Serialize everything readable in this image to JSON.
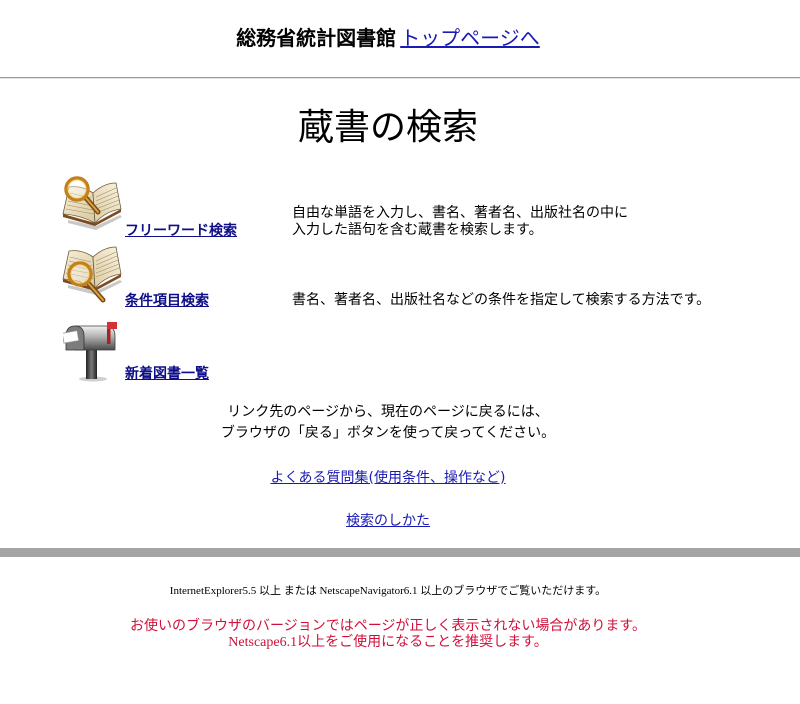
{
  "header": {
    "org_name": "総務省統計図書館",
    "top_link_label": "トップページへ"
  },
  "page_title": "蔵書の検索",
  "menu": [
    {
      "icon": "book-magnifier-icon",
      "label": "フリーワード検索",
      "description": [
        "自由な単語を入力し、書名、著者名、出版社名の中に",
        "入力した語句を含む蔵書を検索します。"
      ]
    },
    {
      "icon": "book-magnifier-icon",
      "label": "条件項目検索",
      "description": [
        "書名、著者名、出版社名などの条件を指定して検索する方法です。"
      ]
    },
    {
      "icon": "mailbox-icon",
      "label": "新着図書一覧",
      "description": []
    }
  ],
  "back_note": [
    "リンク先のページから、現在のページに戻るには、",
    "ブラウザの「戻る」ボタンを使って戻ってください。"
  ],
  "links": {
    "faq_label": "よくある質問集(使用条件、操作など)",
    "howto_label": "検索のしかた"
  },
  "footer": {
    "browser_note": "InternetExplorer5.5 以上 または NetscapeNavigator6.1 以上のブラウザでご覧いただけます。",
    "warning": [
      "お使いのブラウザのバージョンではページが正しく表示されない場合があります。",
      "Netscape6.1以上をご使用になることを推奨します。"
    ]
  },
  "colors": {
    "link": "#1a1ab4",
    "menu_link": "#0e0e88",
    "warning": "#d0103a",
    "divider": "#a4a4a4"
  }
}
